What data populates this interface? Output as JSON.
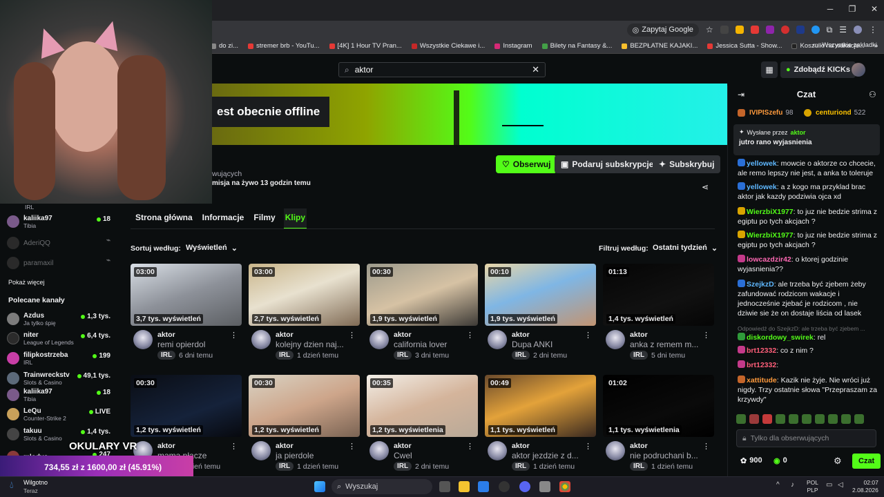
{
  "browser": {
    "zapytaj_label": "Zapytaj Google",
    "all_bookmarks": "Wszystkie zakładki",
    "bookmarks": [
      "do zi...",
      "stremer brb - YouTu...",
      "[4K] 1 Hour TV Pran...",
      "Wszystkie Ciekawe i...",
      "Instagram",
      "Bilety na Fantasy &...",
      "BEZPŁATNE KAJAKI...",
      "Jessica Sutta - Show...",
      "Koszulki na wakacje..."
    ],
    "bookmark_colors": [
      "#888",
      "#e53935",
      "#e53935",
      "#c62828",
      "#d62976",
      "#43a047",
      "#fbc02d",
      "#e53935",
      "#222"
    ]
  },
  "header": {
    "search_value": "aktor",
    "kicks_label": "Zdobądź KICKs"
  },
  "channel": {
    "offline_text": "est obecnie offline",
    "followers_text": "wujących",
    "last_stream_text": "misja na żywo 13 godzin temu",
    "follow_label": "Obserwuj",
    "gift_label": "Podaruj subskrypcje",
    "subscribe_label": "Subskrybuj",
    "tabs": [
      "Strona główna",
      "Informacje",
      "Filmy",
      "Klipy"
    ],
    "sort_label": "Sortuj według:",
    "sort_value": "Wyświetleń",
    "filter_label": "Filtruj według:",
    "filter_value": "Ostatni tydzień"
  },
  "clips": [
    {
      "duration": "03:00",
      "views": "3,7 tys. wyświetleń",
      "author": "aktor",
      "title": "remi opierdol",
      "tag": "IRL",
      "age": "6 dni temu",
      "bg": "linear-gradient(160deg,#d9dfe6,#8d9199 50%,#5c5f63)"
    },
    {
      "duration": "03:00",
      "views": "2,7 tys. wyświetleń",
      "author": "aktor",
      "title": "kolejny dzien naj...",
      "tag": "IRL",
      "age": "1 dzień temu",
      "bg": "linear-gradient(160deg,#c9b58a,#e8e1cf 45%,#806b55)"
    },
    {
      "duration": "00:30",
      "views": "1,9 tys. wyświetleń",
      "author": "aktor",
      "title": "california lover",
      "tag": "IRL",
      "age": "3 dni temu",
      "bg": "linear-gradient(160deg,#9c9a8c,#d6c2a4 50%,#3d3a36)"
    },
    {
      "duration": "00:10",
      "views": "1,9 tys. wyświetleń",
      "author": "aktor",
      "title": "Dupa ANKI",
      "tag": "IRL",
      "age": "2 dni temu",
      "bg": "linear-gradient(160deg,#e8d6a8,#7fb6e4 45%,#c29472)"
    },
    {
      "duration": "01:13",
      "views": "1,4 tys. wyświetleń",
      "author": "aktor",
      "title": "anka z remem m...",
      "tag": "IRL",
      "age": "5 dni temu",
      "bg": "linear-gradient(160deg,#050505,#111 60%,#050505)"
    },
    {
      "duration": "00:30",
      "views": "1,2 tys. wyświetleń",
      "author": "aktor",
      "title": "mama płacze",
      "tag": "IRL",
      "age": "1 dzień temu",
      "bg": "linear-gradient(160deg,#0a0d14,#15223a 60%,#07090e)"
    },
    {
      "duration": "00:30",
      "views": "1,2 tys. wyświetleń",
      "author": "aktor",
      "title": "ja pierdole",
      "tag": "IRL",
      "age": "1 dzień temu",
      "bg": "linear-gradient(160deg,#d9d3c4,#cda58a 50%,#7a6353)"
    },
    {
      "duration": "00:35",
      "views": "1,2 tys. wyświetlenia",
      "author": "aktor",
      "title": "Cwel",
      "tag": "IRL",
      "age": "2 dni temu",
      "bg": "linear-gradient(160deg,#f3efe8,#d4b49b 50%,#b8a998)"
    },
    {
      "duration": "00:49",
      "views": "1,1 tys. wyświetleń",
      "author": "aktor",
      "title": "aktor jezdzie z d...",
      "tag": "IRL",
      "age": "1 dzień temu",
      "bg": "linear-gradient(160deg,#6a4a2c,#e3a23a 45%,#3b2a20)"
    },
    {
      "duration": "01:02",
      "views": "1,1 tys. wyświetlenia",
      "author": "aktor",
      "title": "nie podruchani b...",
      "tag": "IRL",
      "age": "1 dzień temu",
      "bg": "linear-gradient(160deg,#000,#0a0a0a 60%,#000)"
    }
  ],
  "sidebar": {
    "top_cat": "IRL",
    "channels": [
      {
        "name": "kaliika97",
        "cat": "Tibia",
        "viewers": "18",
        "online": true,
        "color": "#7a5a8a"
      },
      {
        "name": "AderiQQ",
        "cat": "",
        "viewers": "",
        "online": false,
        "color": "#333"
      },
      {
        "name": "paramaxil",
        "cat": "",
        "viewers": "",
        "online": false,
        "color": "#333"
      }
    ],
    "show_more": "Pokaż więcej",
    "recommended_title": "Polecane kanały",
    "recommended": [
      {
        "name": "Azdus",
        "cat": "Ja tylko śpię",
        "viewers": "1,3 tys.",
        "color": "#7c7c7c"
      },
      {
        "name": "niter",
        "cat": "League of Legends",
        "viewers": "6,4 tys.",
        "color": "#2b2b2b"
      },
      {
        "name": "filipkostrzeba",
        "cat": "IRL",
        "viewers": "199",
        "color": "#c83ea6"
      },
      {
        "name": "Trainwreckstv",
        "cat": "Slots & Casino",
        "viewers": "49,1 tys.",
        "color": "#5c6a7a"
      },
      {
        "name": "kaliika97",
        "cat": "Tibia",
        "viewers": "18",
        "color": "#7a5a8a"
      },
      {
        "name": "LeQu",
        "cat": "Counter-Strike 2",
        "viewers": "LIVE",
        "color": "#c9a15a"
      },
      {
        "name": "takuu",
        "cat": "Slots & Casino",
        "viewers": "1,4 tys.",
        "color": "#444"
      },
      {
        "name": "mlodyo",
        "cat": "",
        "viewers": "247",
        "color": "#8a3a3a"
      }
    ]
  },
  "overlay": {
    "okulary": "OKULARY VR",
    "ticker": "734,55 zł z 1600,00 zł (45.91%)"
  },
  "chat": {
    "title": "Czat",
    "top_users": [
      {
        "name": "IVIPISzefu",
        "count": "98"
      },
      {
        "name": "centuriond",
        "count": "522"
      }
    ],
    "pinned_by": "Wysłane przez",
    "pinned_user": "aktor",
    "pinned_text": "jutro rano wyjasnienia",
    "messages": [
      {
        "user": "yellowek",
        "color": "#5fb8ff",
        "badge": "#2a6fd6",
        "text": "mowcie o aktorze co chcecie, ale remo lepszy nie jest, a anka to toleruje"
      },
      {
        "user": "yellowek",
        "color": "#5fb8ff",
        "badge": "#2a6fd6",
        "text": "a z kogo ma przyklad brac aktor jak kazdy podziwia ojca xd"
      },
      {
        "user": "WierzbiX1977",
        "color": "#53fc18",
        "badge": "#d9a400",
        "text": "to juz nie bedzie strima z egiptu po tych akcjach ?"
      },
      {
        "user": "WierzbiX1977",
        "color": "#53fc18",
        "badge": "#d9a400",
        "text": "to juz nie bedzie strima z egiptu po tych akcjach ?"
      },
      {
        "user": "lowcazdzir42",
        "color": "#ff69b4",
        "badge": "#c43a8a",
        "text": "o ktorej godzinie wyjasnienia??"
      },
      {
        "user": "SzejkzD",
        "color": "#5fb8ff",
        "badge": "#2a6fd6",
        "text": "ale trzeba być zjebem żeby zafundować rodzicom wakacje i jednocześnie zjebać je rodzicom , nie dziwie sie że on dostaje liścia od lasek"
      },
      {
        "user": "diskordowy_swirek",
        "color": "#53fc18",
        "badge": "#2f9a3a",
        "text": "rel"
      },
      {
        "user": "brt12332",
        "color": "#ff5f7a",
        "badge": "#c43a8a",
        "text": "co z nim ?"
      },
      {
        "user": "brt12332",
        "color": "#ff5f7a",
        "badge": "#c43a8a",
        "text": ""
      },
      {
        "user": "xattitude",
        "color": "#ff9a3c",
        "badge": "#c4652a",
        "text": "Kazik nie żyje. Nie wróci już nigdy. Trzy ostatnie słowa \"Przepraszam za krzywdy\""
      }
    ],
    "reply_note": "Odpowiedź do SzejkzD: ale trzeba być zjebem ...",
    "input_placeholder": "Tylko dla obserwujących",
    "kicks_count": "900",
    "other_count": "0",
    "send_label": "Czat"
  },
  "taskbar": {
    "weather_title": "Wilgotno",
    "weather_sub": "Teraz",
    "search_label": "Wyszukaj",
    "lang1": "POL",
    "lang2": "PLP",
    "time": "02:07",
    "date": "2.08.2026"
  }
}
